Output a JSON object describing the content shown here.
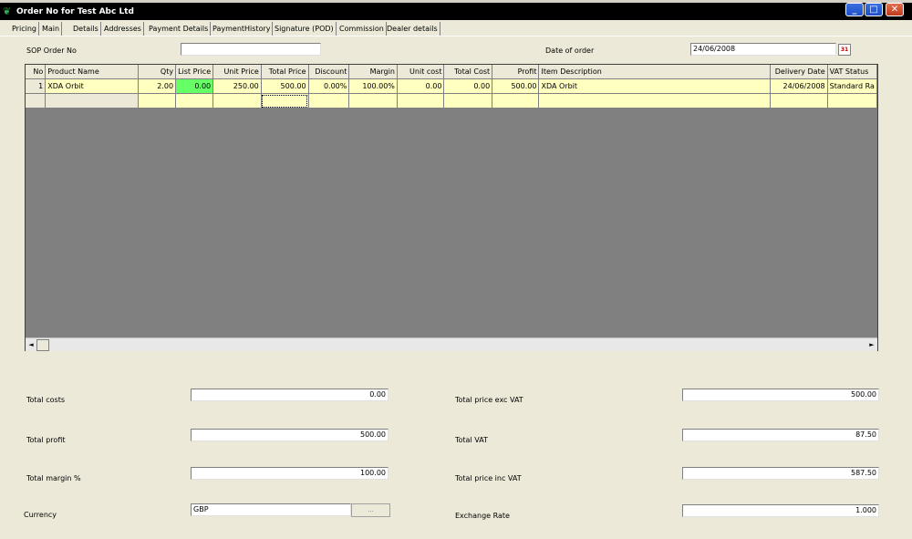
{
  "window": {
    "title": "Order No  for Test Abc Ltd",
    "controls": {
      "minimize": "_",
      "maximize": "□",
      "close": "✕"
    },
    "icon": "app-leaf-icon"
  },
  "tabs": [
    "Pricing",
    "Main",
    "Details",
    "Addresses",
    "Payment Details",
    "PaymentHistory",
    "Signature (POD)",
    "Commission",
    "Dealer details"
  ],
  "header": {
    "sop_label": "SOP Order No",
    "sop_value": "",
    "date_label": "Date of order",
    "date_value": "24/06/2008",
    "calendar_icon": "calendar-icon",
    "calendar_text": "31"
  },
  "grid": {
    "columns": [
      "No",
      "Product Name",
      "Qty",
      "List Price",
      "Unit Price",
      "Total Price",
      "Discount",
      "Margin",
      "Unit cost",
      "Total Cost",
      "Profit",
      "Item Description",
      "Delivery Date",
      "VAT Status"
    ],
    "rows": [
      [
        "1",
        "XDA Orbit",
        "2.00",
        "0.00",
        "250.00",
        "500.00",
        "0.00%",
        "100.00%",
        "0.00",
        "0.00",
        "500.00",
        "XDA Orbit",
        "24/06/2008",
        "Standard Ra"
      ],
      [
        "",
        "",
        "",
        "",
        "",
        "",
        "",
        "",
        "",
        "",
        "",
        "",
        "",
        ""
      ]
    ],
    "scroll_left": "◄",
    "scroll_right": "►"
  },
  "totals": {
    "total_costs_label": "Total costs",
    "total_costs": "0.00",
    "total_profit_label": "Total profit",
    "total_profit": "500.00",
    "total_margin_label": "Total margin %",
    "total_margin": "100.00",
    "currency_label": "Currency",
    "currency": "GBP",
    "currency_button": "...",
    "price_exc_vat_label": "Total price exc VAT",
    "price_exc_vat": "500.00",
    "total_vat_label": "Total VAT",
    "total_vat": "87.50",
    "price_inc_vat_label": "Total price inc VAT",
    "price_inc_vat": "587.50",
    "exchange_rate_label": "Exchange Rate",
    "exchange_rate": "1.000"
  },
  "colors": {
    "grid_row": "#ffffc0",
    "list_price_cell": "#66ff66",
    "grid_bg": "#808080"
  }
}
